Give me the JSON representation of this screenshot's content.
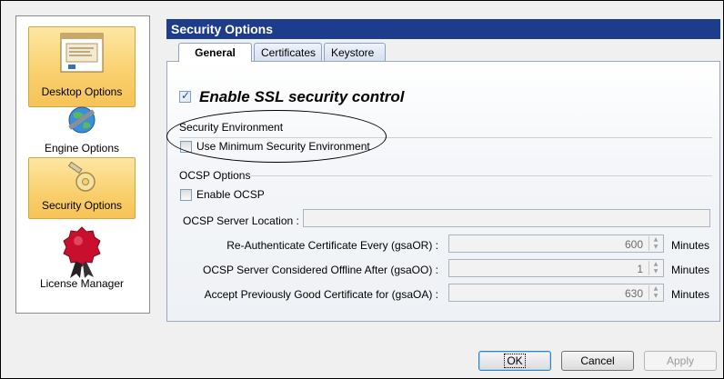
{
  "nav": {
    "items": [
      {
        "label": "Desktop Options",
        "icon": "document-icon",
        "selected": false
      },
      {
        "label": "Engine Options",
        "icon": "globe-icon",
        "selected": false
      },
      {
        "label": "Security Options",
        "icon": "key-icon",
        "selected": true
      },
      {
        "label": "License Manager",
        "icon": "seal-icon",
        "selected": false
      }
    ]
  },
  "header": {
    "title": "Security Options"
  },
  "tabs": [
    {
      "label": "General",
      "active": true
    },
    {
      "label": "Certificates",
      "active": false
    },
    {
      "label": "Keystore",
      "active": false
    }
  ],
  "general": {
    "ssl_label": "Enable SSL security control",
    "ssl_checked": true,
    "security_env_title": "Security Environment",
    "min_env_label": "Use Minimum Security Environment",
    "ocsp_title": "OCSP Options",
    "enable_ocsp_label": "Enable OCSP",
    "server_location_label": "OCSP Server Location :",
    "server_location_value": "",
    "reauth_label": "Re-Authenticate Certificate Every (gsaOR) :",
    "reauth_value": "600",
    "offline_label": "OCSP Server Considered Offline After (gsaOO) :",
    "offline_value": "1",
    "accept_label": "Accept Previously Good Certificate for (gsaOA) :",
    "accept_value": "630",
    "units": "Minutes"
  },
  "buttons": {
    "ok": "OK",
    "cancel": "Cancel",
    "apply": "Apply"
  },
  "colors": {
    "header": "#1d3d8c",
    "selection": "#f9cf6c"
  }
}
